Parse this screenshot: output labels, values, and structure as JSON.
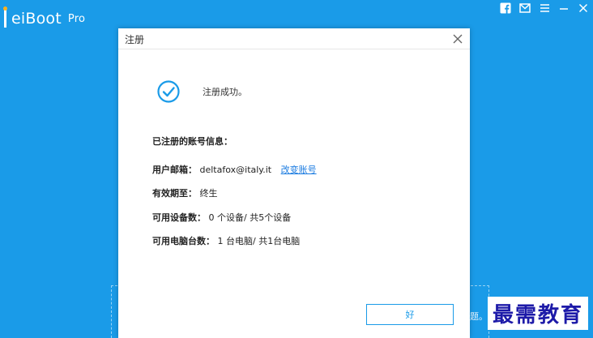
{
  "app": {
    "logo_main": "eiBoot",
    "logo_pro": "Pro"
  },
  "window_controls": [
    "facebook-icon",
    "mail-icon",
    "menu-icon",
    "minimize-icon",
    "close-icon"
  ],
  "dialog": {
    "title": "注册",
    "success_message": "注册成功。",
    "info_title": "已注册的账号信息：",
    "email_label": "用户邮箱：",
    "email_value": "deltafox@italy.it",
    "change_account": "改变账号",
    "valid_label": "有效期至：",
    "valid_value": "终生",
    "devices_label": "可用设备数：",
    "devices_value": "0 个设备/ 共5个设备",
    "computers_label": "可用电脑台数：",
    "computers_value": "1 台电脑/ 共1台电脑",
    "ok_button": "好"
  },
  "background": {
    "hint_text": "题。"
  },
  "watermark": "最需教育",
  "colors": {
    "background": "#1a9be8",
    "accent": "#1a9be8",
    "link": "#1a7be0",
    "logo_dot": "#ffb21e"
  }
}
